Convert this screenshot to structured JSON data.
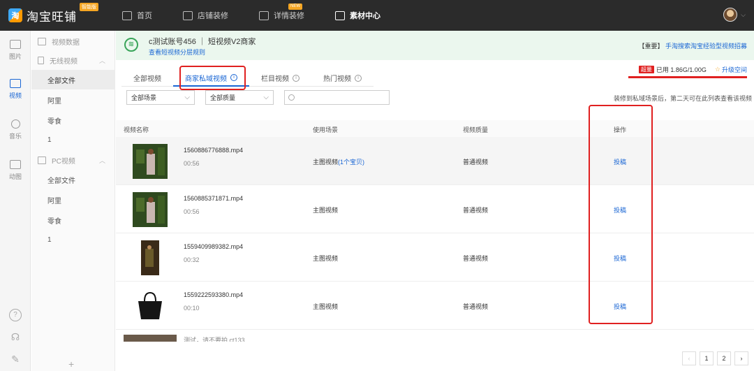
{
  "app": {
    "name": "淘宝旺铺",
    "badge": "智能版"
  },
  "nav": [
    {
      "label": "首页",
      "icon": "home-icon",
      "active": false
    },
    {
      "label": "店铺装修",
      "icon": "store-icon",
      "active": false
    },
    {
      "label": "详情装修",
      "icon": "detail-icon",
      "active": false,
      "badge": "NEW"
    },
    {
      "label": "素材中心",
      "icon": "folder-icon",
      "active": true
    }
  ],
  "rail": [
    {
      "label": "图片",
      "icon": "image-icon"
    },
    {
      "label": "视频",
      "icon": "video-icon",
      "active": true
    },
    {
      "label": "音乐",
      "icon": "music-icon"
    },
    {
      "label": "动图",
      "icon": "gif-icon"
    }
  ],
  "sidebar": {
    "video_data": "视频数据",
    "wireless": "无线视频",
    "wireless_items": [
      "全部文件",
      "阿里",
      "零食",
      "1"
    ],
    "pc": "PC视频",
    "pc_items": [
      "全部文件",
      "阿里",
      "零食",
      "1"
    ],
    "add": "+"
  },
  "notice": {
    "title": "c测试账号456 ｜ 短视频V2商家",
    "link": "查看短视频分层规则",
    "right_tag": "【重要】",
    "right_link": "手淘搜索淘宝经验型视频招募"
  },
  "tabs": [
    {
      "label": "全部视频",
      "info": false,
      "active": false
    },
    {
      "label": "商家私域视频",
      "info": true,
      "active": true
    },
    {
      "label": "栏目视频",
      "info": true,
      "active": false
    },
    {
      "label": "热门视频",
      "info": true,
      "active": false
    }
  ],
  "storage": {
    "tag": "超量",
    "used": "已用 1.86G/1.00G",
    "upgrade": "升级空间",
    "used_fraction": 1.0,
    "color": "#e02020"
  },
  "filters": {
    "scene": "全部场景",
    "quality": "全部质量",
    "search_placeholder": "",
    "note": "装修到私域场景后，第二天可在此列表查看该视频"
  },
  "table": {
    "headers": [
      "视频名称",
      "使用场景",
      "视频质量",
      "操作"
    ],
    "rows": [
      {
        "file": "1560886776888.mp4",
        "duration": "00:56",
        "scene": "主图视频",
        "scene_link": "(1个宝贝)",
        "quality": "普通视频",
        "action": "投稿"
      },
      {
        "file": "1560885371871.mp4",
        "duration": "00:56",
        "scene": "主图视频",
        "scene_link": "",
        "quality": "普通视频",
        "action": "投稿"
      },
      {
        "file": "1559409989382.mp4",
        "duration": "00:32",
        "scene": "主图视频",
        "scene_link": "",
        "quality": "普通视频",
        "action": "投稿"
      },
      {
        "file": "1559222593380.mp4",
        "duration": "00:10",
        "scene": "主图视频",
        "scene_link": "",
        "quality": "普通视频",
        "action": "投稿"
      }
    ],
    "partial_row_text": "测试，请不要拍 ct133"
  },
  "pager": {
    "prev": "‹",
    "pages": [
      "1",
      "2"
    ],
    "next": "›"
  },
  "colors": {
    "accent": "#1a66d4",
    "highlight": "#e02020",
    "topbar": "#2b2b2b"
  }
}
